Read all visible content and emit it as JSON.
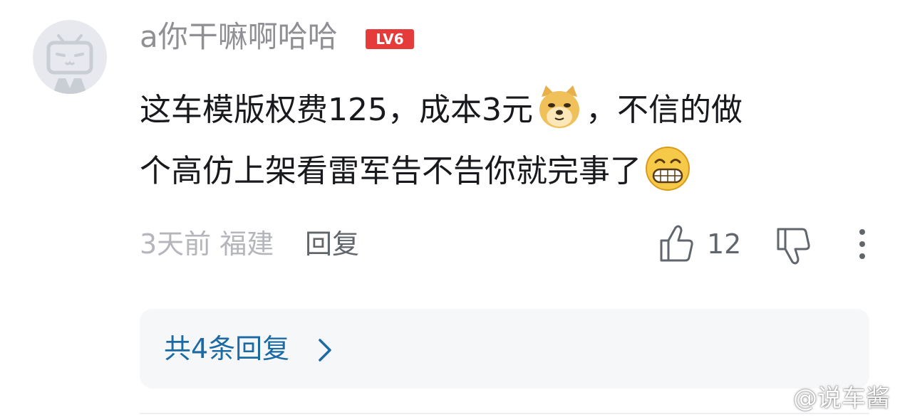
{
  "comment": {
    "username": "a你干嘛啊哈哈",
    "level": "LV6",
    "content_line1_a": "这车模版权费125，成本3元",
    "content_line1_b": "，不信的做",
    "content_line2": "个高仿上架看雷军告不告你就完事了",
    "emoji1": "doge-emoji",
    "emoji2": "grin-emoji",
    "time_location": "3天前 福建",
    "reply_label": "回复",
    "like_count": "12"
  },
  "replies": {
    "summary": "共4条回复"
  },
  "watermark": "@说车酱",
  "colors": {
    "username": "#8f8f94",
    "level_badge": "#e63b3b",
    "link": "#1b6aa3",
    "text": "#18191c"
  }
}
